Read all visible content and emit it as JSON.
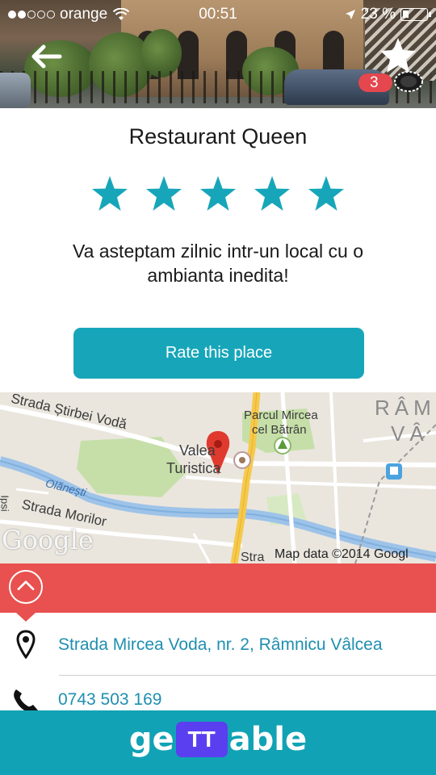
{
  "status_bar": {
    "carrier": "orange",
    "time": "00:51",
    "battery": "23 %"
  },
  "header": {
    "favorites_count": "3"
  },
  "restaurant": {
    "name": "Restaurant Queen",
    "rating": 5,
    "rating_max": 5,
    "description": "Va asteptam zilnic intr-un local cu o ambianta inedita!"
  },
  "actions": {
    "rate_label": "Rate this place"
  },
  "map": {
    "labels": {
      "street1": "Strada Știrbei Vodă",
      "place1_line1": "Valea",
      "place1_line2": "Turistica",
      "park_line1": "Parcul Mircea",
      "park_line2": "cel Bătrân",
      "river": "Olănești",
      "street2": "Strada Morilor",
      "district_line1": "RÂM",
      "district_line2": "VÂ",
      "street3": "Stra",
      "side": "Ipsi"
    },
    "attribution": "Map data ©2014 Googl",
    "logo": "Google"
  },
  "contact": {
    "address": "Strada Mircea Voda, nr. 2, Râmnicu Vâlcea",
    "phone": "0743 503 169"
  },
  "footer": {
    "brand_left": "ge",
    "brand_mid": "TT",
    "brand_right": "able"
  },
  "colors": {
    "accent": "#17a6b9",
    "red_bar": "#e8514f",
    "link": "#1f8fb0"
  }
}
